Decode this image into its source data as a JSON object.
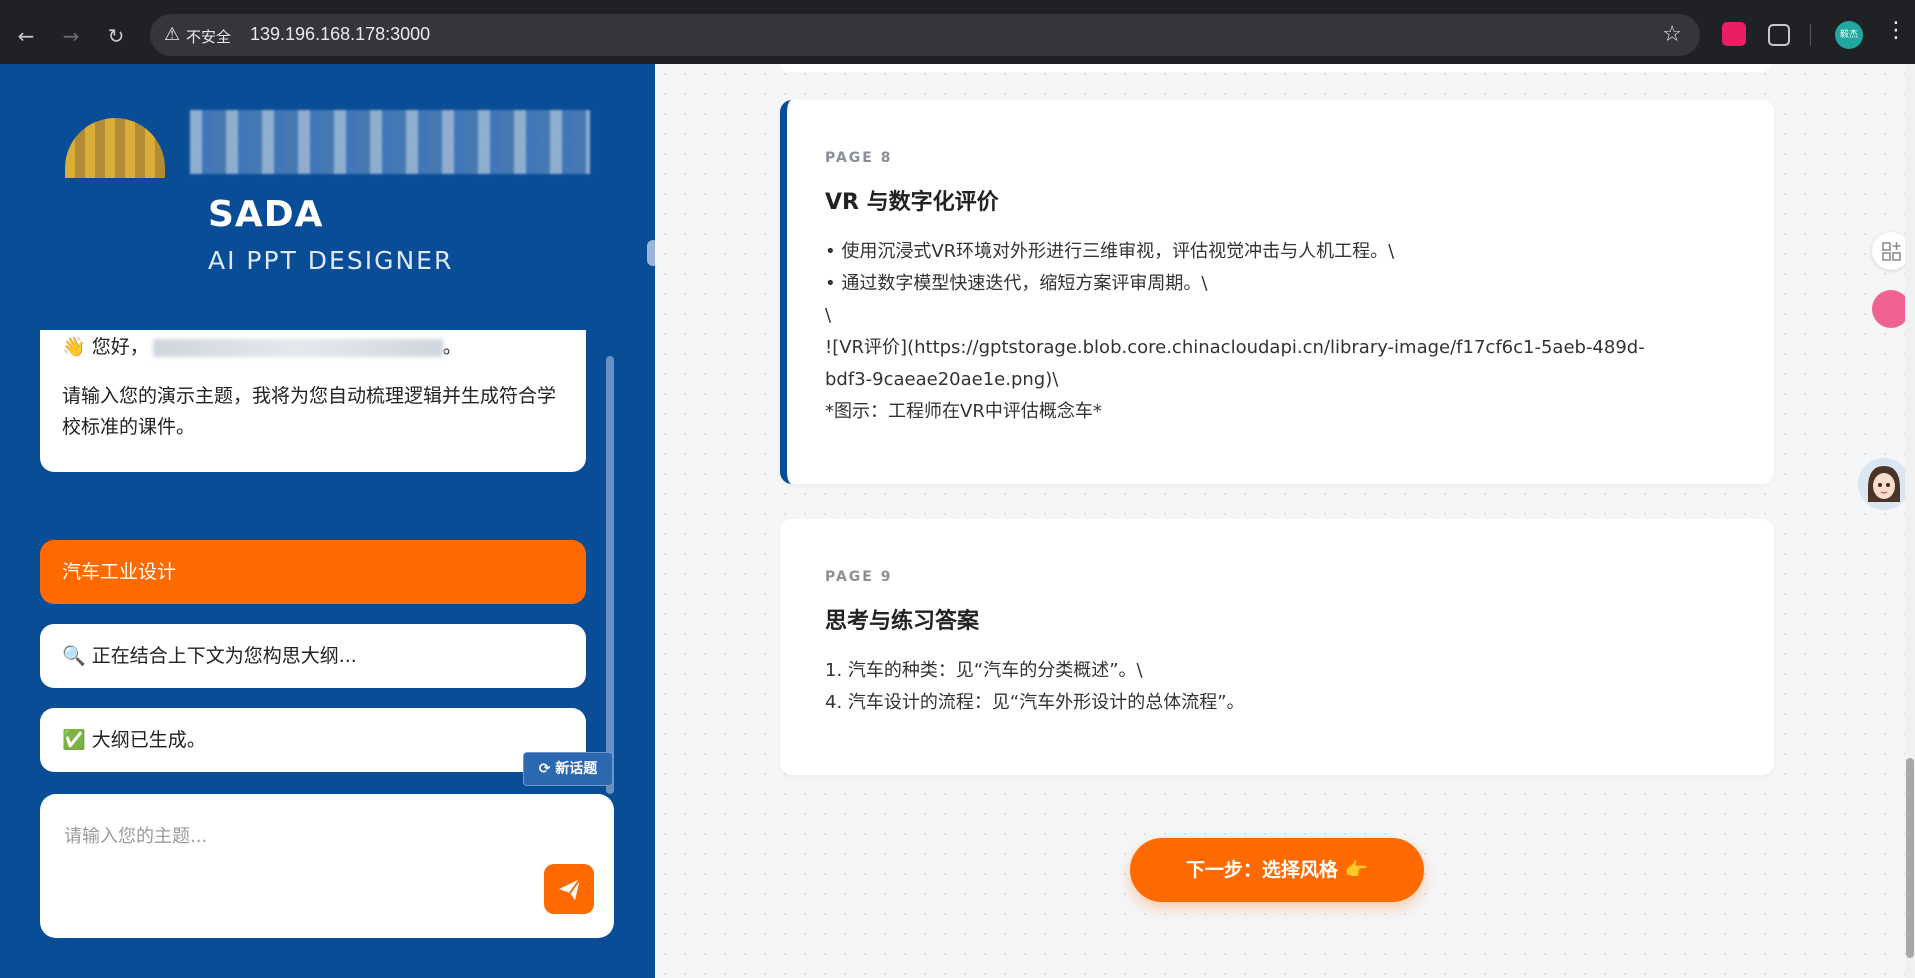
{
  "browser": {
    "security_label": "不安全",
    "url": "139.196.168.178:3000",
    "profile_label": "毅杰"
  },
  "sidebar": {
    "brand_title": "SADA",
    "brand_subtitle": "AI PPT DESIGNER",
    "messages": {
      "welcome_greeting": "👋 您好，",
      "welcome_greeting_end": "。",
      "welcome_body": "请输入您的演示主题，我将为您自动梳理逻辑并生成符合学校标准的课件。",
      "user_topic": "汽车工业设计",
      "status_generating": "🔍 正在结合上下文为您构思大纲...",
      "status_done": "✅ 大纲已生成。"
    },
    "new_topic_label": "新话题",
    "input_placeholder": "请输入您的主题..."
  },
  "main": {
    "pages": [
      {
        "label": "PAGE 8",
        "title": "VR 与数字化评价",
        "body": "• 使用沉浸式VR环境对外形进行三维审视，评估视觉冲击与人机工程。\\\n• 通过数字模型快速迭代，缩短方案评审周期。\\\n\\\n![VR评价](https://gptstorage.blob.core.chinacloudapi.cn/library-image/f17cf6c1-5aeb-489d-\nbdf3-9caeae20ae1e.png)\\\n*图示：工程师在VR中评估概念车*"
      },
      {
        "label": "PAGE 9",
        "title": "思考与练习答案",
        "body": "1. 汽车的种类：见“汽车的分类概述”。\\\n4. 汽车设计的流程：见“汽车外形设计的总体流程”。"
      }
    ],
    "next_button_label": "下一步：选择风格 👉"
  },
  "colors": {
    "sidebar_bg": "#0a4d97",
    "accent_orange": "#ff6a00",
    "page_bg": "#f5f6f8"
  }
}
